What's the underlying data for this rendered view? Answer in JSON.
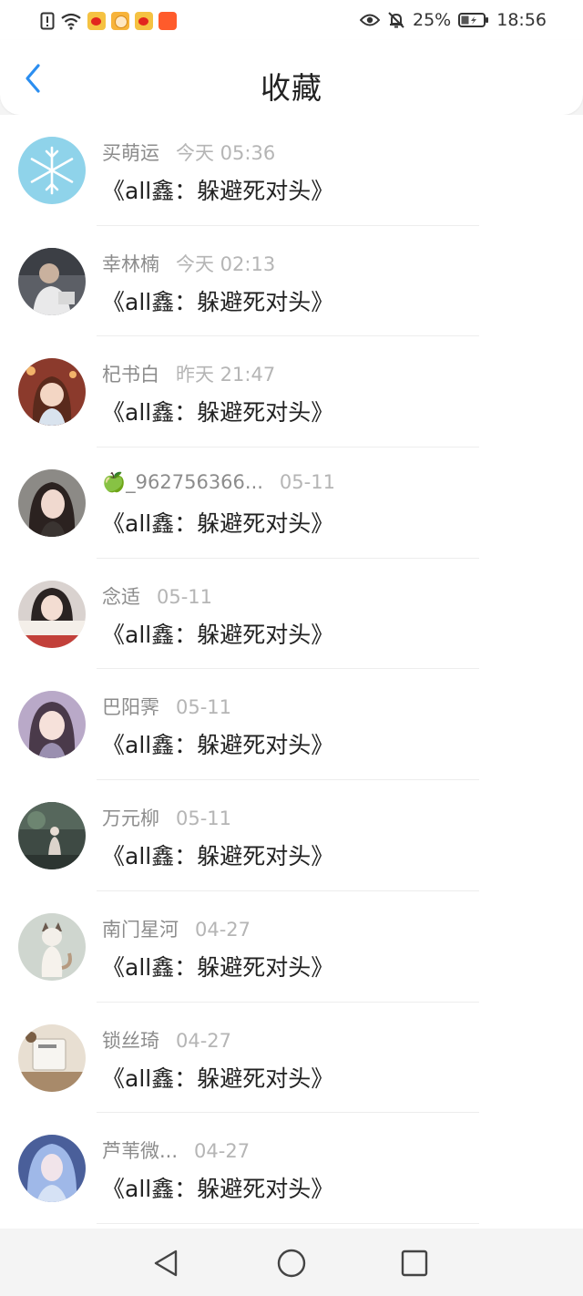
{
  "status_bar": {
    "battery": "25%",
    "time": "18:56",
    "icons": [
      "alert-icon",
      "wifi-icon",
      "weibo-app-icon",
      "face-app-icon",
      "weibo-app-icon",
      "shop-app-icon",
      "eye-icon",
      "bell-off-icon",
      "battery-icon"
    ]
  },
  "header": {
    "title": "收藏"
  },
  "items": [
    {
      "name": "买萌运",
      "time": "今天 05:36",
      "novel": "《all鑫：躲避死对头》"
    },
    {
      "name": "幸林楠",
      "time": "今天 02:13",
      "novel": "《all鑫：躲避死对头》"
    },
    {
      "name": "杞书白",
      "time": "昨天 21:47",
      "novel": "《all鑫：躲避死对头》"
    },
    {
      "name": "🍏_962756366...",
      "time": "05-11",
      "novel": "《all鑫：躲避死对头》"
    },
    {
      "name": "念适",
      "time": "05-11",
      "novel": "《all鑫：躲避死对头》"
    },
    {
      "name": "巴阳霁",
      "time": "05-11",
      "novel": "《all鑫：躲避死对头》"
    },
    {
      "name": "万元柳",
      "time": "05-11",
      "novel": "《all鑫：躲避死对头》"
    },
    {
      "name": "南门星河",
      "time": "04-27",
      "novel": "《all鑫：躲避死对头》"
    },
    {
      "name": "锁丝琦",
      "time": "04-27",
      "novel": "《all鑫：躲避死对头》"
    },
    {
      "name": "芦苇微...",
      "time": "04-27",
      "novel": "《all鑫：躲避死对头》"
    }
  ],
  "colors": {
    "accent": "#2b8ef0"
  }
}
